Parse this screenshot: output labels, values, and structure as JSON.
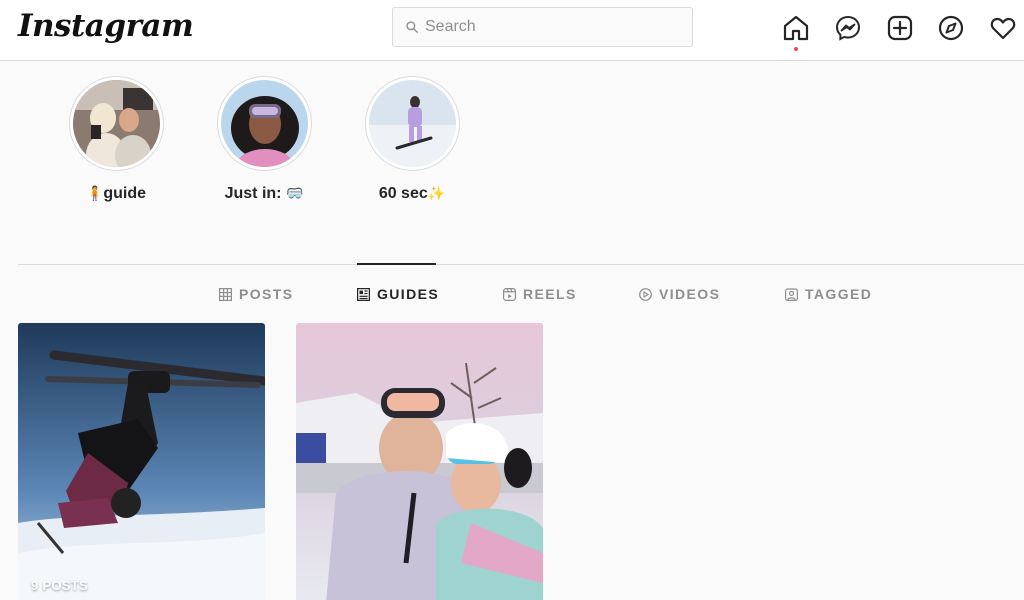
{
  "header": {
    "logo_text": "Instagram",
    "search": {
      "placeholder": "Search",
      "value": ""
    },
    "nav_icons": [
      "home-icon",
      "messenger-icon",
      "new-post-icon",
      "explore-icon",
      "activity-heart-icon"
    ]
  },
  "highlights": [
    {
      "title": "guide",
      "emoji": "🧍"
    },
    {
      "title": "Just in: ",
      "emoji": "🥽"
    },
    {
      "title": "60 sec",
      "emoji": "✨"
    }
  ],
  "tabs": [
    {
      "label": "POSTS",
      "icon": "grid-icon",
      "active": false
    },
    {
      "label": "GUIDES",
      "icon": "guide-icon",
      "active": true
    },
    {
      "label": "REELS",
      "icon": "reels-icon",
      "active": false
    },
    {
      "label": "VIDEOS",
      "icon": "video-play-icon",
      "active": false
    },
    {
      "label": "TAGGED",
      "icon": "tagged-icon",
      "active": false
    }
  ],
  "guides": [
    {
      "count_label": "9 POSTS"
    },
    {
      "count_label": ""
    }
  ],
  "colors": {
    "accent_dot": "#ed4956",
    "text_primary": "#262626",
    "text_muted": "#8e8e8e",
    "border": "#dbdbdb"
  }
}
